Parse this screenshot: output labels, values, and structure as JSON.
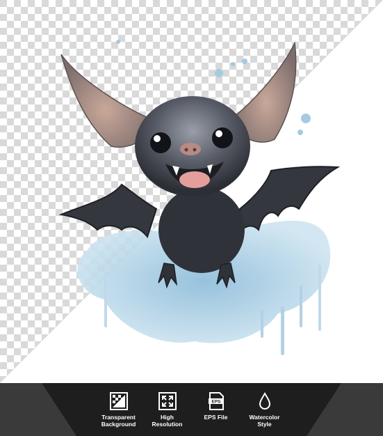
{
  "features": [
    {
      "icon": "transparent-checker-icon",
      "label": "Transparent\nBackground"
    },
    {
      "icon": "expand-arrows-icon",
      "label": "High\nResolution"
    },
    {
      "icon": "eps-file-icon",
      "label": "EPS File"
    },
    {
      "icon": "water-drop-icon",
      "label": "Watercolor\nStyle"
    }
  ],
  "colors": {
    "footer_bg": "#1e1e1e",
    "footer_corner": "#3a3a3a",
    "checker_light": "#ffffff",
    "checker_dark": "#d9d9d9",
    "bat_fur": "#3b3d45",
    "watercolor": "#a9cde3"
  }
}
